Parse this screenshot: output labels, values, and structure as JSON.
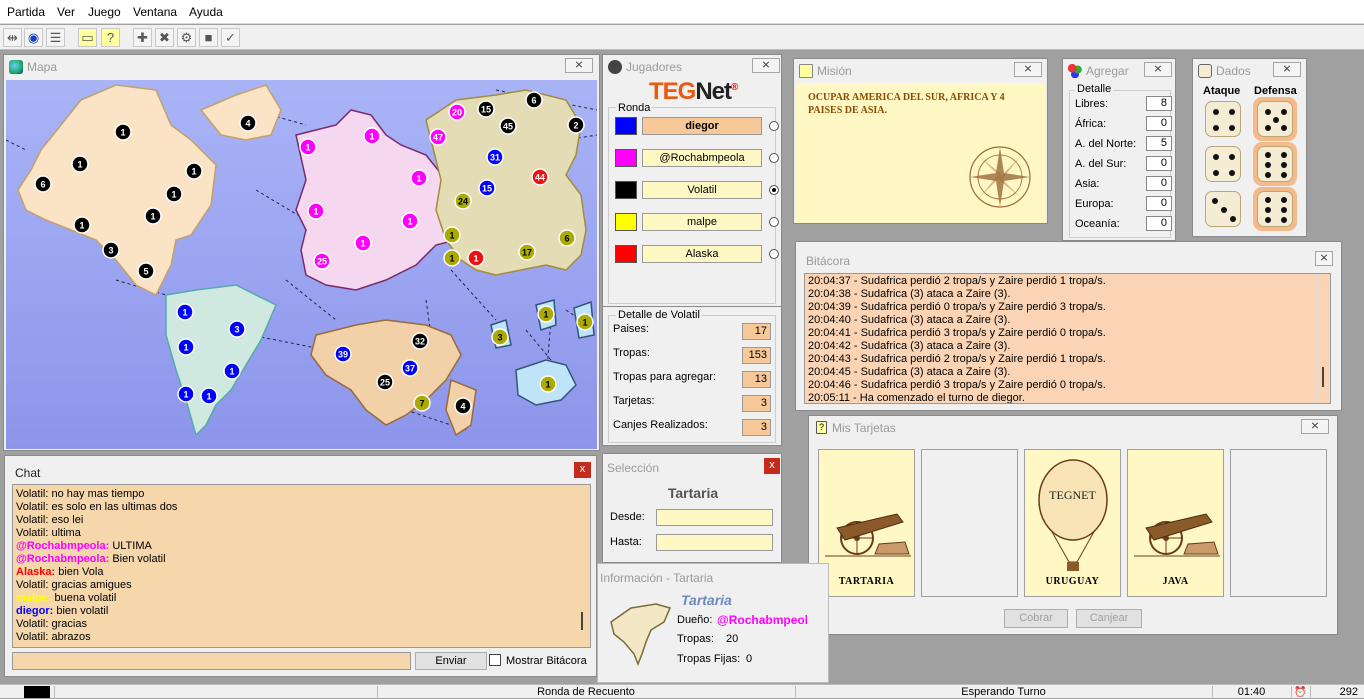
{
  "menu": [
    "Partida",
    "Ver",
    "Juego",
    "Ventana",
    "Ayuda"
  ],
  "map_window": {
    "title": "Mapa",
    "close": "⨯"
  },
  "territories": [
    "1",
    "1",
    "4",
    "1",
    "6",
    "1",
    "1",
    "1",
    "3",
    "5",
    "1",
    "3",
    "1",
    "1",
    "1",
    "1",
    "1",
    "1",
    "1",
    "1",
    "1",
    "25",
    "1",
    "20",
    "15",
    "45",
    "6",
    "47",
    "31",
    "15",
    "44",
    "2",
    "24",
    "1",
    "1",
    "1",
    "6",
    "17",
    "39",
    "32",
    "37",
    "25",
    "7",
    "4",
    "3",
    "1",
    "1",
    "1"
  ],
  "players_window": {
    "title": "Jugadores",
    "logo_a": "TEG",
    "logo_b": "Net",
    "logo_reg": "®",
    "group_label": "Ronda",
    "players": [
      {
        "name": "diegor",
        "color": "#0000ff"
      },
      {
        "name": "@Rochabmpeola",
        "color": "#ff00ff"
      },
      {
        "name": "Volatil",
        "color": "#000000"
      },
      {
        "name": "malpe",
        "color": "#ffff00"
      },
      {
        "name": "Alaska",
        "color": "#ff0000"
      }
    ],
    "detail_label": "Detalle de Volatil",
    "stats": [
      {
        "label": "Paises:",
        "value": "17"
      },
      {
        "label": "Tropas:",
        "value": "153"
      },
      {
        "label": "Tropas para agregar:",
        "value": "13"
      },
      {
        "label": "Tarjetas:",
        "value": "3"
      },
      {
        "label": "Canjes Realizados:",
        "value": "3"
      }
    ]
  },
  "mission_window": {
    "title": "Misión",
    "text": "OCUPAR AMERICA DEL SUR, AFRICA Y 4 PAISES DE ASIA."
  },
  "add_window": {
    "title": "Agregar",
    "group_label": "Detalle",
    "rows": [
      {
        "label": "Libres:",
        "value": "8"
      },
      {
        "label": "África:",
        "value": "0"
      },
      {
        "label": "A. del Norte:",
        "value": "5"
      },
      {
        "label": "A. del Sur:",
        "value": "0"
      },
      {
        "label": "Asia:",
        "value": "0"
      },
      {
        "label": "Europa:",
        "value": "0"
      },
      {
        "label": "Oceanía:",
        "value": "0"
      }
    ]
  },
  "dice_window": {
    "title": "Dados",
    "attack_label": "Ataque",
    "defense_label": "Defensa",
    "attack": [
      4,
      4,
      3
    ],
    "defense": [
      5,
      6,
      6
    ]
  },
  "log_window": {
    "title": "Bitácora",
    "lines": [
      "20:04:37 - Sudafrica perdió 2 tropa/s y Zaire perdió 1 tropa/s.",
      "20:04:38 - Sudafrica (3) ataca a Zaire (3).",
      "20:04:39 - Sudafrica perdió 0 tropa/s y Zaire perdió 3 tropa/s.",
      "20:04:40 - Sudafrica (3) ataca a Zaire (3).",
      "20:04:41 - Sudafrica perdió 3 tropa/s y Zaire perdió 0 tropa/s.",
      "20:04:42 - Sudafrica (3) ataca a Zaire (3).",
      "20:04:43 - Sudafrica perdió 2 tropa/s y Zaire perdió 1 tropa/s.",
      "20:04:45 - Sudafrica (3) ataca a Zaire (3).",
      "20:04:46 - Sudafrica perdió 3 tropa/s y Zaire perdió 0 tropa/s.",
      "20:05:11 - Ha comenzado el turno de diegor."
    ]
  },
  "cards_window": {
    "title": "Mis Tarjetas",
    "cards": [
      {
        "label": "TARTARIA",
        "kind": "cannon"
      },
      {
        "label": "",
        "kind": "empty"
      },
      {
        "label": "URUGUAY",
        "kind": "balloon",
        "balloon_text": "TEGNET"
      },
      {
        "label": "JAVA",
        "kind": "cannon"
      },
      {
        "label": "",
        "kind": "empty"
      }
    ],
    "collect_label": "Cobrar",
    "exchange_label": "Canjear"
  },
  "chat_window": {
    "title": "Chat",
    "messages": [
      {
        "author": "Volatil:",
        "text": "no hay mas tiempo",
        "color": "#000000"
      },
      {
        "author": "Volatil:",
        "text": "es solo en las ultimas dos",
        "color": "#000000"
      },
      {
        "author": "Volatil:",
        "text": "eso lei",
        "color": "#000000"
      },
      {
        "author": "Volatil:",
        "text": "ultima",
        "color": "#000000"
      },
      {
        "author": "@Rochabmpeola:",
        "text": "ULTIMA",
        "color": "#ff00ff"
      },
      {
        "author": "@Rochabmpeola:",
        "text": "Bien volatil",
        "color": "#ff00ff"
      },
      {
        "author": "Alaska:",
        "text": "bien Vola",
        "color": "#ff0000"
      },
      {
        "author": "Volatil:",
        "text": "gracias amigues",
        "color": "#000000"
      },
      {
        "author": "malpe:",
        "text": "buena volatil",
        "color": "#ffff00"
      },
      {
        "author": "diegor:",
        "text": "bien volatil",
        "color": "#0000ff"
      },
      {
        "author": "Volatil:",
        "text": "gracias",
        "color": "#000000"
      },
      {
        "author": "Volatil:",
        "text": "abrazos",
        "color": "#000000"
      }
    ],
    "send_label": "Enviar",
    "show_log_label": "Mostrar Bitácora"
  },
  "selection_window": {
    "title": "Selección",
    "country": "Tartaria",
    "from_label": "Desde:",
    "to_label": "Hasta:"
  },
  "info_window": {
    "title": "Información - Tartaria",
    "country": "Tartaria",
    "owner_label": "Dueño:",
    "owner": "@Rochabmpeola",
    "troops_label": "Tropas:",
    "troops": "20",
    "fixed_label": "Tropas Fijas:",
    "fixed": "0"
  },
  "status_bar": {
    "phase": "Ronda de Recuento",
    "state": "Esperando Turno",
    "time": "01:40",
    "ping": "292"
  }
}
